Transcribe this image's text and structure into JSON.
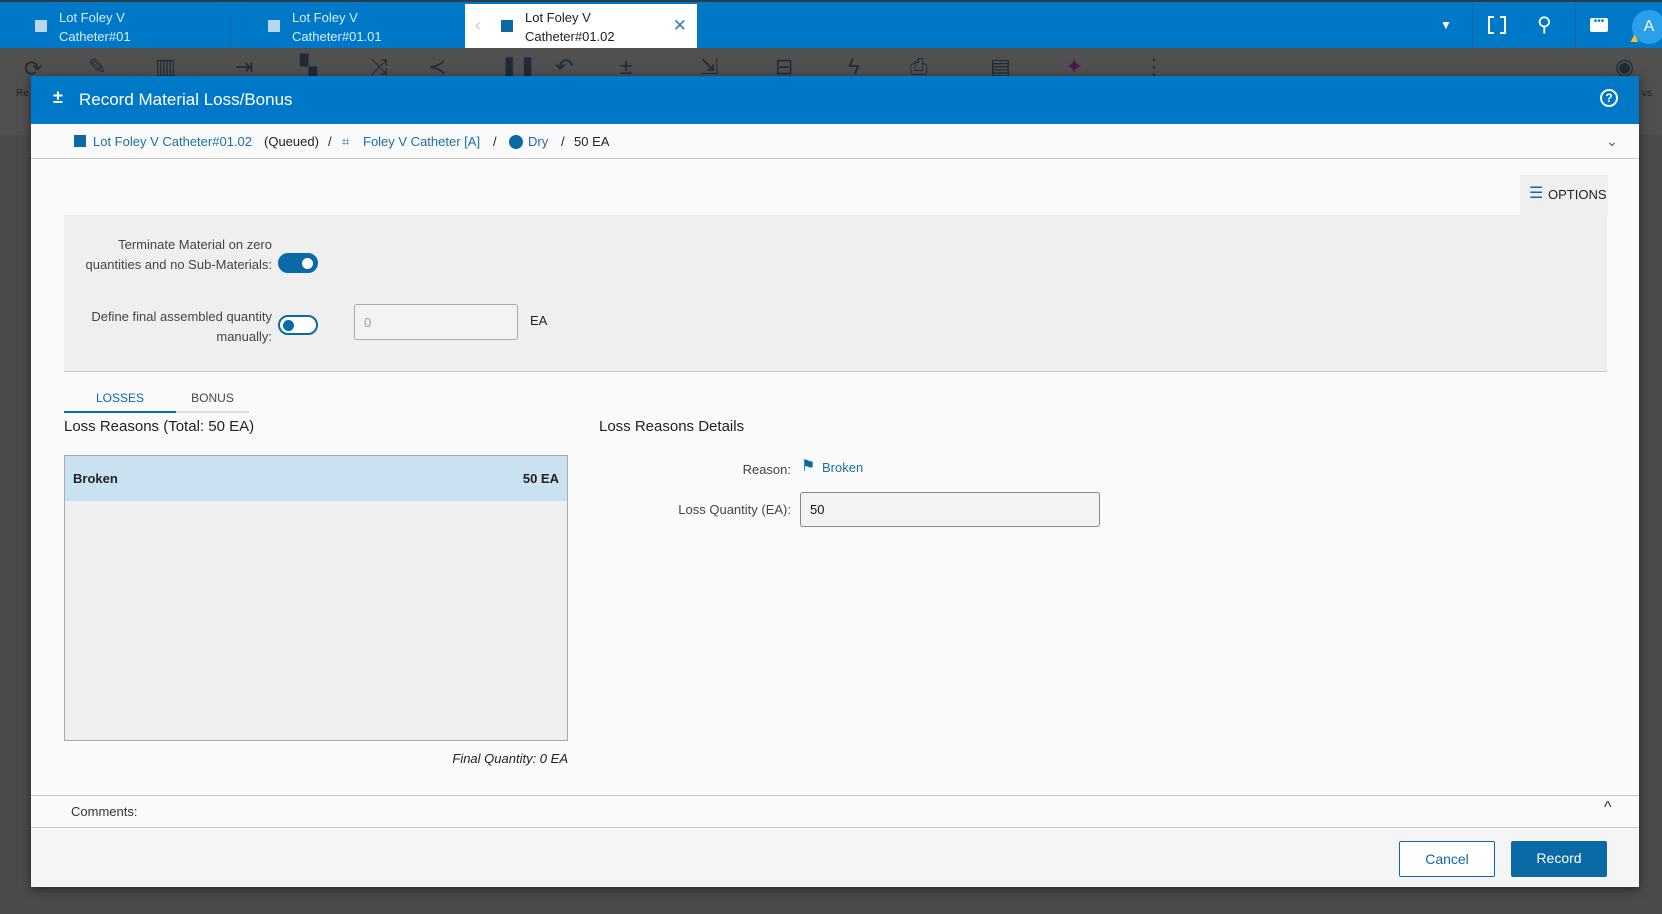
{
  "tabs": [
    {
      "line1": "Lot Foley V",
      "line2": "Catheter#01"
    },
    {
      "line1": "Lot Foley V",
      "line2": "Catheter#01.01"
    },
    {
      "line1": "Lot Foley V",
      "line2": "Catheter#01.02"
    }
  ],
  "header": {
    "avatar": "A"
  },
  "toolbar": {
    "refresh_partial": "Re",
    "views_partial": "vs"
  },
  "dialog": {
    "title": "Record Material Loss/Bonus",
    "breadcrumb": {
      "material": "Lot Foley V Catheter#01.02",
      "state": "(Queued)",
      "product": "Foley V Catheter [A]",
      "step": "Dry",
      "quantity": "50 EA",
      "sep": "/"
    },
    "options_label": "OPTIONS",
    "terminate_label": "Terminate Material on zero quantities and no Sub-Materials:",
    "terminate_on": true,
    "define_label": "Define final assembled quantity manually:",
    "define_on": false,
    "define_value": "0",
    "define_unit": "EA",
    "tabs": [
      "LOSSES",
      "BONUS"
    ],
    "loss_title": "Loss Reasons (Total: 50 EA)",
    "loss_items": [
      {
        "reason": "Broken",
        "qty": "50 EA"
      }
    ],
    "final_quantity": "Final Quantity: 0 EA",
    "details_title": "Loss Reasons Details",
    "reason_label": "Reason:",
    "reason_value": "Broken",
    "qty_label": "Loss Quantity (EA):",
    "qty_value": "50",
    "comments_label": "Comments:",
    "cancel": "Cancel",
    "record": "Record"
  },
  "colors": {
    "brand": "#0078c8",
    "primary_button": "#0a6aa6",
    "selected_row": "#c9e1f1"
  }
}
